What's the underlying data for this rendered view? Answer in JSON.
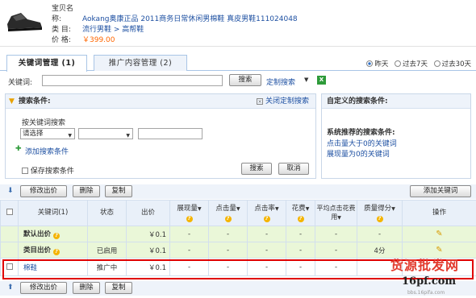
{
  "product": {
    "labels": {
      "name": "宝贝名称:",
      "category": "类    目:",
      "price": "价    格:"
    },
    "name": "Aokang奥康正品 2011商务日常休闲男棉鞋 真皮男鞋111024048",
    "category": "流行男鞋 > 高帮鞋",
    "price": "￥399.00",
    "image_icon": "shoe-photo"
  },
  "tabs": [
    {
      "label": "关键词管理 (1)",
      "active": true
    },
    {
      "label": "推广内容管理 (2)",
      "active": false
    }
  ],
  "range": {
    "options": [
      "昨天",
      "过去7天",
      "过去30天"
    ],
    "selected": "昨天"
  },
  "keyword_bar": {
    "label": "关键词:",
    "value": "",
    "search_label": "搜索",
    "custom_search_label": "定制搜索",
    "excel_icon": "excel-icon"
  },
  "search_panel": {
    "title": "搜索条件:",
    "close_label": "关闭定制搜索",
    "by_keyword_label": "按关键词搜索",
    "select1": "请选择",
    "select2": "",
    "value": "",
    "add_condition_label": "添加搜索条件",
    "save_label": "保存搜索条件",
    "search_label": "搜索",
    "cancel_label": "取消"
  },
  "custom_panel": {
    "title": "自定义的搜索条件:",
    "recommended_title": "系统推荐的搜索条件:",
    "links": [
      "点击量大于0的关键词",
      "展现量为0的关键词"
    ]
  },
  "toolbar": {
    "edit_price": "修改出价",
    "delete": "删除",
    "copy": "复制",
    "add_keyword": "添加关键词"
  },
  "table": {
    "headers": [
      "关键词(1)",
      "状态",
      "出价",
      "展现量",
      "点击量",
      "点击率",
      "花费",
      "平均点击花费用",
      "质量得分",
      "操作"
    ],
    "rows": [
      {
        "keyword": "默认出价",
        "status": "",
        "bid": "￥0.1",
        "impressions": "-",
        "clicks": "-",
        "ctr": "-",
        "cost": "-",
        "avg_cpc": "-",
        "quality": "-",
        "type": "summary"
      },
      {
        "keyword": "类目出价",
        "status": "已启用",
        "bid": "￥0.1",
        "impressions": "-",
        "clicks": "-",
        "ctr": "-",
        "cost": "-",
        "avg_cpc": "-",
        "quality": "4分",
        "type": "summary"
      },
      {
        "keyword": "棉鞋",
        "status": "推广中",
        "bid": "￥0.1",
        "impressions": "-",
        "clicks": "-",
        "ctr": "-",
        "cost": "-",
        "avg_cpc": "-",
        "quality": "",
        "type": "keyword"
      }
    ]
  },
  "watermark": {
    "line1": "货源批发网",
    "line2": "16pf.com",
    "line3": "bbs.16pifa.com"
  },
  "colors": {
    "accent": "#1e50a2",
    "price": "#ff6600",
    "highlight": "#e00000",
    "summary_bg": "#eaf7d8"
  }
}
